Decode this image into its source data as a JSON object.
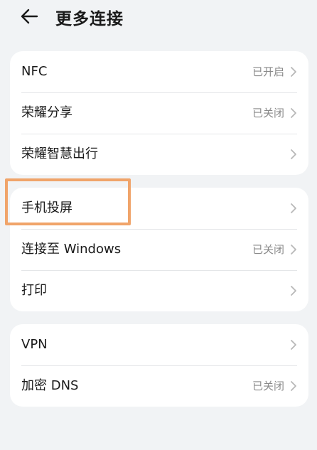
{
  "header": {
    "back_icon": "arrow-left-icon",
    "title": "更多连接"
  },
  "groups": [
    {
      "items": [
        {
          "label": "NFC",
          "status": "已开启"
        },
        {
          "label": "荣耀分享",
          "status": "已关闭"
        },
        {
          "label": "荣耀智慧出行",
          "status": ""
        }
      ]
    },
    {
      "items": [
        {
          "label": "手机投屏",
          "status": ""
        },
        {
          "label": "连接至 Windows",
          "status": "已关闭"
        },
        {
          "label": "打印",
          "status": ""
        }
      ]
    },
    {
      "items": [
        {
          "label": "VPN",
          "status": ""
        },
        {
          "label": "加密 DNS",
          "status": "已关闭"
        }
      ]
    }
  ],
  "chevron_icon": "chevron-right-icon",
  "highlight": {
    "target": "手机投屏",
    "color": "#f0a46a"
  },
  "colors": {
    "background": "#f1f3f5",
    "card": "#ffffff",
    "status_text": "#8a8a8a"
  }
}
